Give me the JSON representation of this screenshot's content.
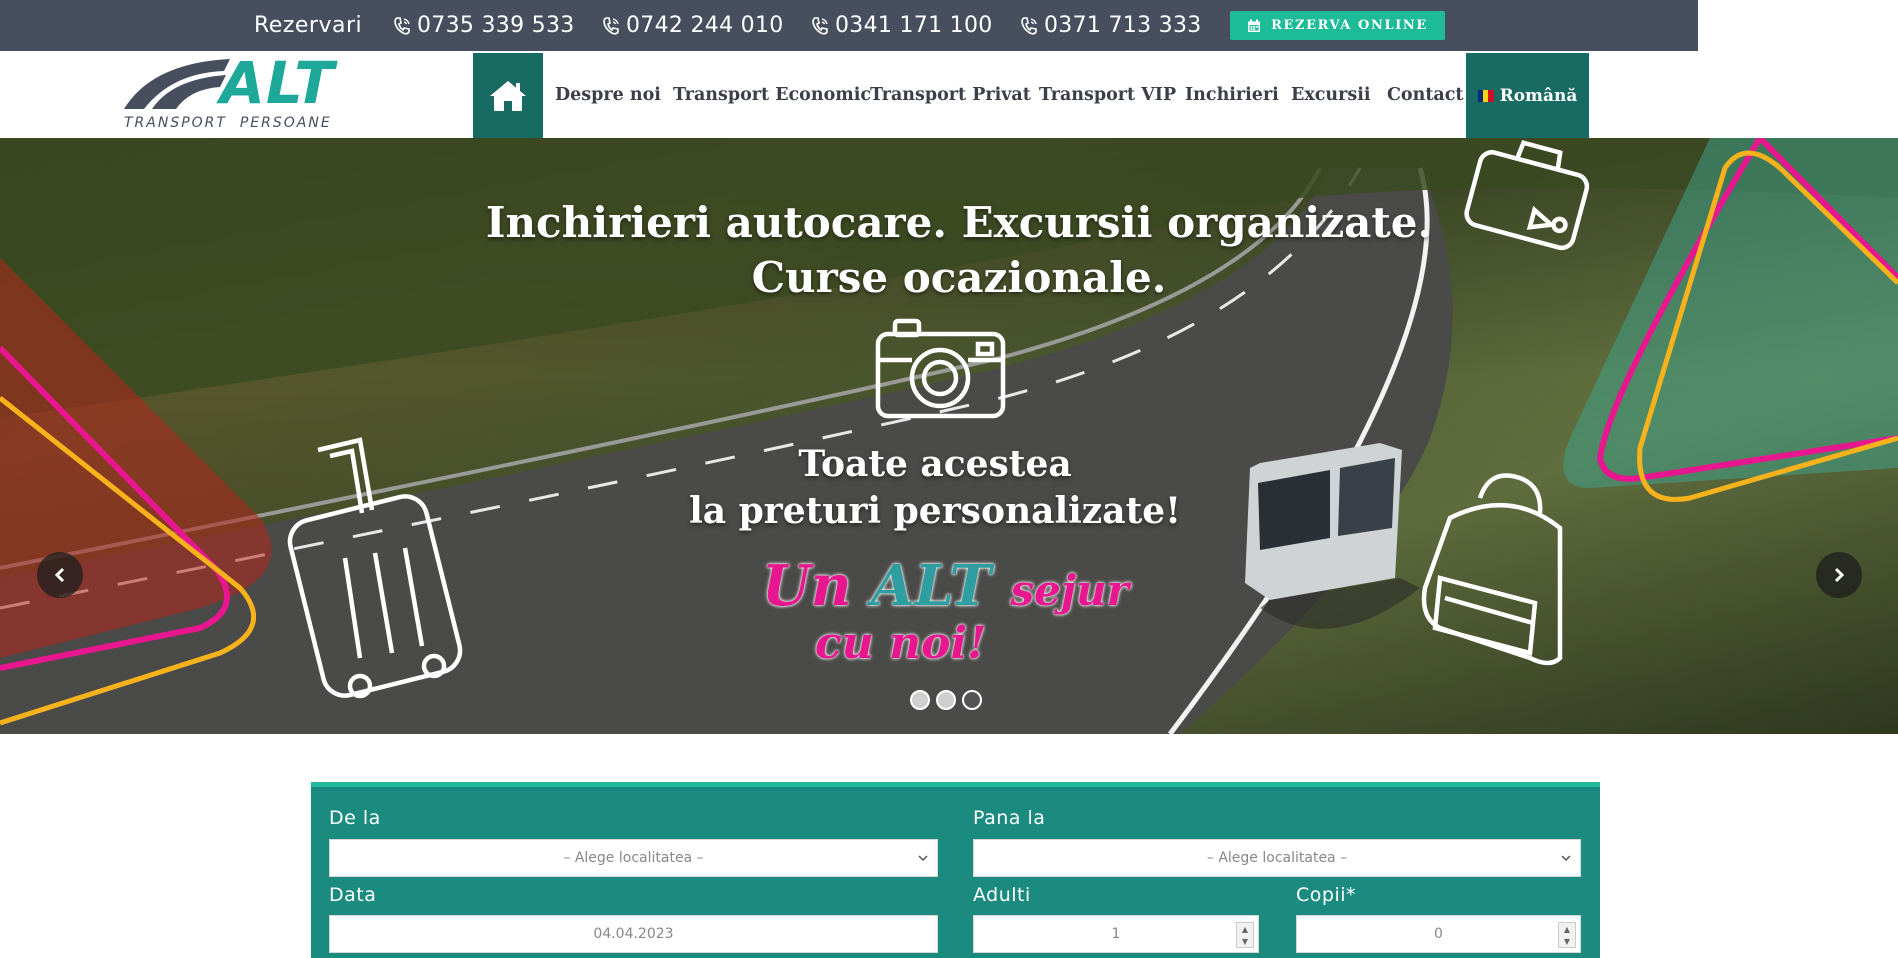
{
  "topbar": {
    "reservations_label": "Rezervari",
    "phones": [
      "0735 339 533",
      "0742 244 010",
      "0341 171 100",
      "0371 713 333"
    ],
    "online_button": "REZERVA ONLINE"
  },
  "logo": {
    "brand": "ALT",
    "tagline": "TRANSPORT  PERSOANE"
  },
  "nav": {
    "items": [
      "Despre noi",
      "Transport Economic",
      "Transport Privat",
      "Transport VIP",
      "Inchirieri",
      "Excursii",
      "Contact"
    ],
    "language": "Română"
  },
  "hero": {
    "title_line1": "Inchirieri autocare. Excursii organizate.",
    "title_line2": "Curse ocazionale.",
    "sub_line1": "Toate acestea",
    "sub_line2": "la preturi personalizate!",
    "slogan_un": "Un",
    "slogan_alt": "ALT",
    "slogan_sejur": "sejur",
    "slogan_line2": "cu noi!"
  },
  "booking": {
    "from_label": "De la",
    "from_placeholder": "– Alege localitatea –",
    "to_label": "Pana la",
    "to_placeholder": "– Alege localitatea –",
    "date_label": "Data",
    "date_value": "04.04.2023",
    "adults_label": "Adulti",
    "adults_value": "1",
    "children_label": "Copii*",
    "children_value": "0"
  },
  "colors": {
    "topbar": "#474f5f",
    "accent": "#1dbb98",
    "nav_active": "#176b62",
    "form_bg": "#1b8a7f",
    "pink": "#e8178f",
    "yellow": "#f8b31c"
  }
}
